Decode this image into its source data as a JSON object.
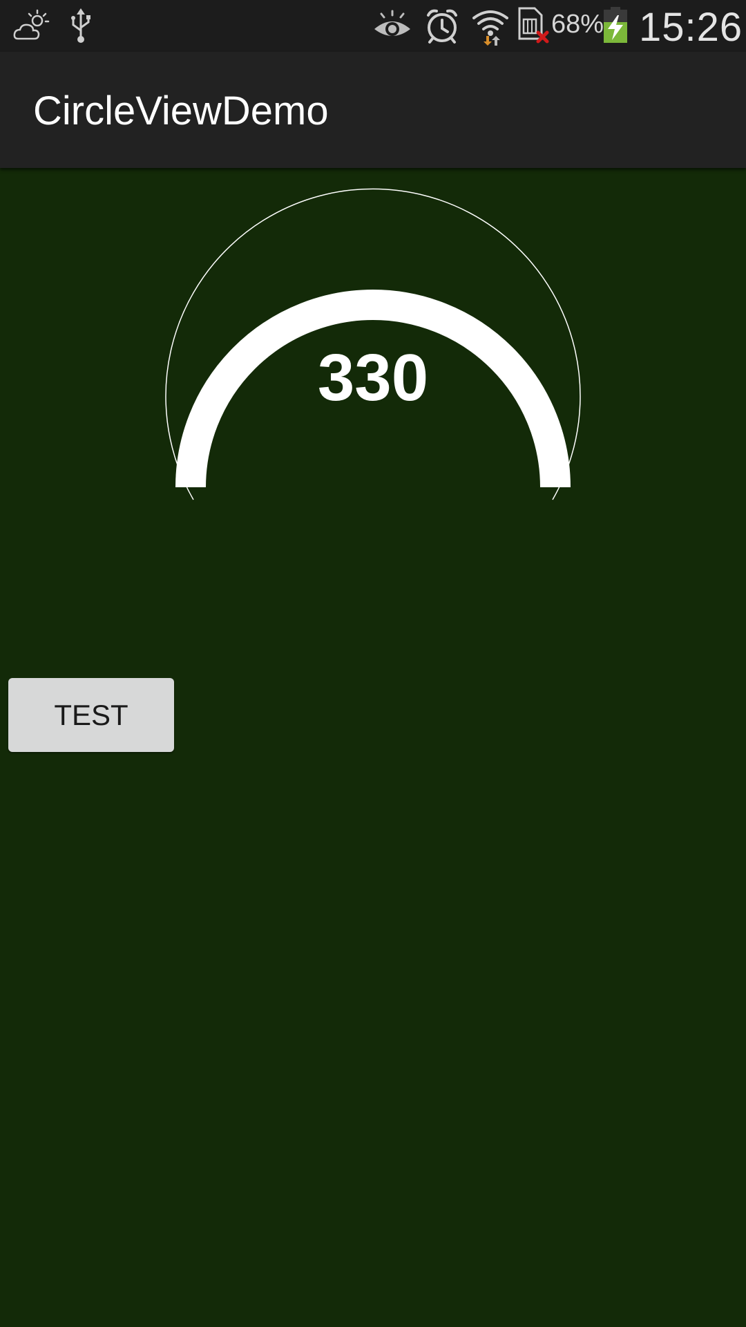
{
  "status_bar": {
    "icons_left": [
      "weather-icon",
      "usb-icon"
    ],
    "icons_right": [
      "eye-icon",
      "alarm-icon",
      "wifi-icon",
      "sim-error-icon",
      "battery-charging-icon"
    ],
    "battery_percent": "68%",
    "time": "15:26",
    "battery_color": "#7cb83a"
  },
  "action_bar": {
    "title": "CircleViewDemo"
  },
  "circle_view": {
    "value": "330",
    "arc_color": "#ffffff"
  },
  "buttons": {
    "test_label": "TEST"
  },
  "colors": {
    "background": "#132a08",
    "status_bar": "#1c1c1c",
    "action_bar": "#222222",
    "button": "#d7d8d8"
  }
}
